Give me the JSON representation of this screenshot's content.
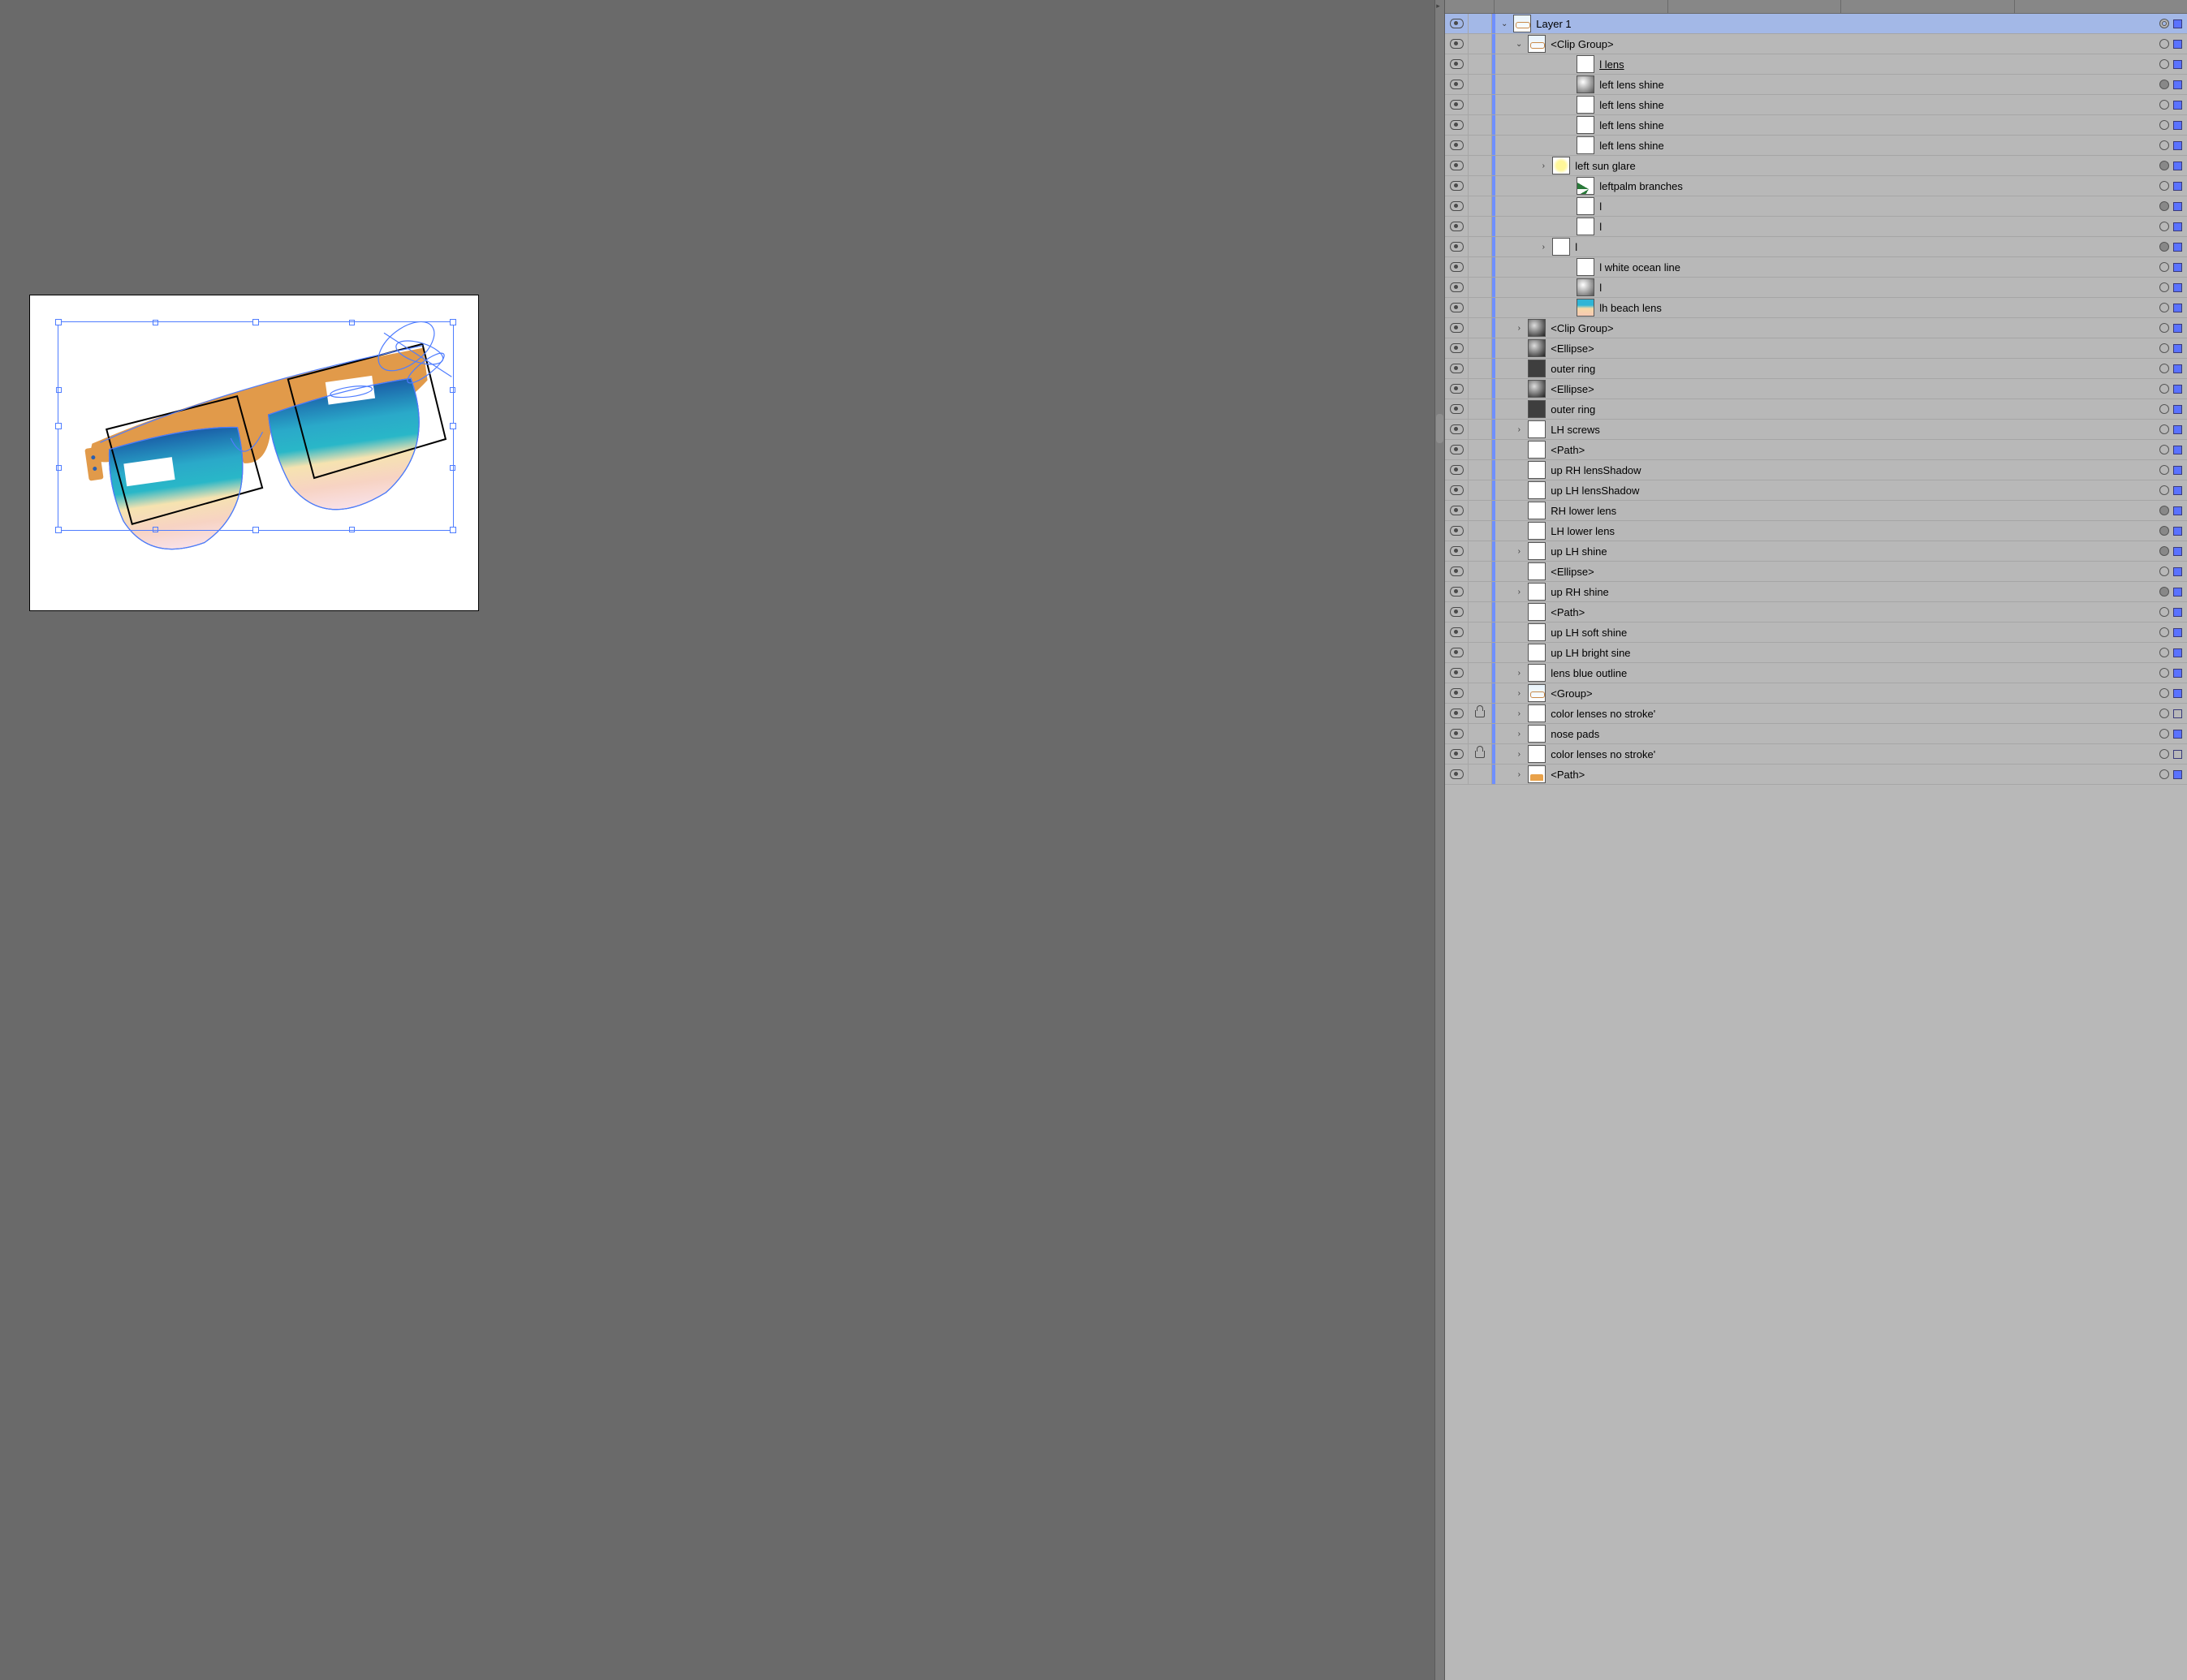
{
  "canvas": {
    "artboard_selected": true
  },
  "layers": {
    "top": {
      "name": "Layer 1",
      "expanded": true,
      "selected": true,
      "target": "dbl",
      "selsq": true
    },
    "items": [
      {
        "name": "<Clip Group>",
        "depth": 1,
        "disclosure": "open",
        "thumb": "glasses",
        "target": "open",
        "selsq": true
      },
      {
        "name": "l lens",
        "depth": 2,
        "thumb": "white",
        "underline": true,
        "target": "open",
        "selsq": true
      },
      {
        "name": "left lens shine",
        "depth": 2,
        "thumb": "grad",
        "target": "fill",
        "selsq": true
      },
      {
        "name": "left lens shine",
        "depth": 2,
        "thumb": "white",
        "target": "open",
        "selsq": true
      },
      {
        "name": "left lens shine",
        "depth": 2,
        "thumb": "white",
        "target": "open",
        "selsq": true
      },
      {
        "name": "left lens shine",
        "depth": 2,
        "thumb": "white",
        "target": "open",
        "selsq": true
      },
      {
        "name": "left sun glare",
        "depth": 2,
        "disclosure": "closed",
        "thumb": "sun",
        "target": "fill",
        "selsq": true
      },
      {
        "name": "leftpalm branches",
        "depth": 2,
        "thumb": "palm",
        "target": "open",
        "selsq": true
      },
      {
        "name": "l",
        "depth": 2,
        "thumb": "white",
        "target": "fill",
        "selsq": true
      },
      {
        "name": "l",
        "depth": 2,
        "thumb": "white",
        "target": "open",
        "selsq": true
      },
      {
        "name": "l",
        "depth": 2,
        "disclosure": "closed",
        "thumb": "white",
        "target": "fill",
        "selsq": true
      },
      {
        "name": "l white ocean line",
        "depth": 2,
        "thumb": "white",
        "target": "open",
        "selsq": true
      },
      {
        "name": "l",
        "depth": 2,
        "thumb": "grad",
        "target": "open",
        "selsq": true
      },
      {
        "name": "lh beach lens",
        "depth": 2,
        "thumb": "beach",
        "target": "open",
        "selsq": true
      },
      {
        "name": "<Clip Group>",
        "depth": 1,
        "disclosure": "closed",
        "thumb": "grad2",
        "target": "open",
        "selsq": true
      },
      {
        "name": "<Ellipse>",
        "depth": 1,
        "thumb": "grad2",
        "target": "open",
        "selsq": true
      },
      {
        "name": "outer ring",
        "depth": 1,
        "thumb": "dark",
        "target": "open",
        "selsq": true
      },
      {
        "name": "<Ellipse>",
        "depth": 1,
        "thumb": "grad2",
        "target": "open",
        "selsq": true
      },
      {
        "name": "outer ring",
        "depth": 1,
        "thumb": "dark",
        "target": "open",
        "selsq": true
      },
      {
        "name": "LH screws",
        "depth": 1,
        "disclosure": "closed",
        "thumb": "white",
        "target": "open",
        "selsq": true
      },
      {
        "name": "<Path>",
        "depth": 1,
        "thumb": "white",
        "target": "open",
        "selsq": true
      },
      {
        "name": "up RH lensShadow",
        "depth": 1,
        "thumb": "white",
        "target": "open",
        "selsq": true
      },
      {
        "name": "up LH lensShadow",
        "depth": 1,
        "thumb": "white",
        "target": "open",
        "selsq": true
      },
      {
        "name": "RH lower lens",
        "depth": 1,
        "thumb": "white",
        "target": "fill",
        "selsq": true
      },
      {
        "name": "LH lower lens",
        "depth": 1,
        "thumb": "white",
        "target": "fill",
        "selsq": true
      },
      {
        "name": "up LH shine",
        "depth": 1,
        "disclosure": "closed",
        "thumb": "white",
        "target": "fill",
        "selsq": true
      },
      {
        "name": "<Ellipse>",
        "depth": 1,
        "thumb": "white",
        "target": "open",
        "selsq": true
      },
      {
        "name": "up RH shine",
        "depth": 1,
        "disclosure": "closed",
        "thumb": "white",
        "target": "fill",
        "selsq": true
      },
      {
        "name": "<Path>",
        "depth": 1,
        "thumb": "white",
        "target": "open",
        "selsq": true
      },
      {
        "name": "up LH soft shine",
        "depth": 1,
        "thumb": "white",
        "target": "open",
        "selsq": true
      },
      {
        "name": "up LH bright sine",
        "depth": 1,
        "thumb": "white",
        "target": "open",
        "selsq": true
      },
      {
        "name": "lens blue outline",
        "depth": 1,
        "disclosure": "closed",
        "thumb": "white",
        "target": "open",
        "selsq": true
      },
      {
        "name": "<Group>",
        "depth": 1,
        "disclosure": "closed",
        "thumb": "glasses",
        "target": "open",
        "selsq": true
      },
      {
        "name": "color lenses no stroke'",
        "depth": 1,
        "disclosure": "closed",
        "thumb": "white",
        "locked": true,
        "target": "open",
        "selsq": false
      },
      {
        "name": "nose pads",
        "depth": 1,
        "disclosure": "closed",
        "thumb": "white",
        "target": "open",
        "selsq": true
      },
      {
        "name": "color lenses no stroke'",
        "depth": 1,
        "disclosure": "closed",
        "thumb": "white",
        "locked": true,
        "target": "open",
        "selsq": false
      },
      {
        "name": "<Path>",
        "depth": 1,
        "disclosure": "closed",
        "thumb": "tan",
        "target": "open",
        "selsq": true
      }
    ]
  }
}
